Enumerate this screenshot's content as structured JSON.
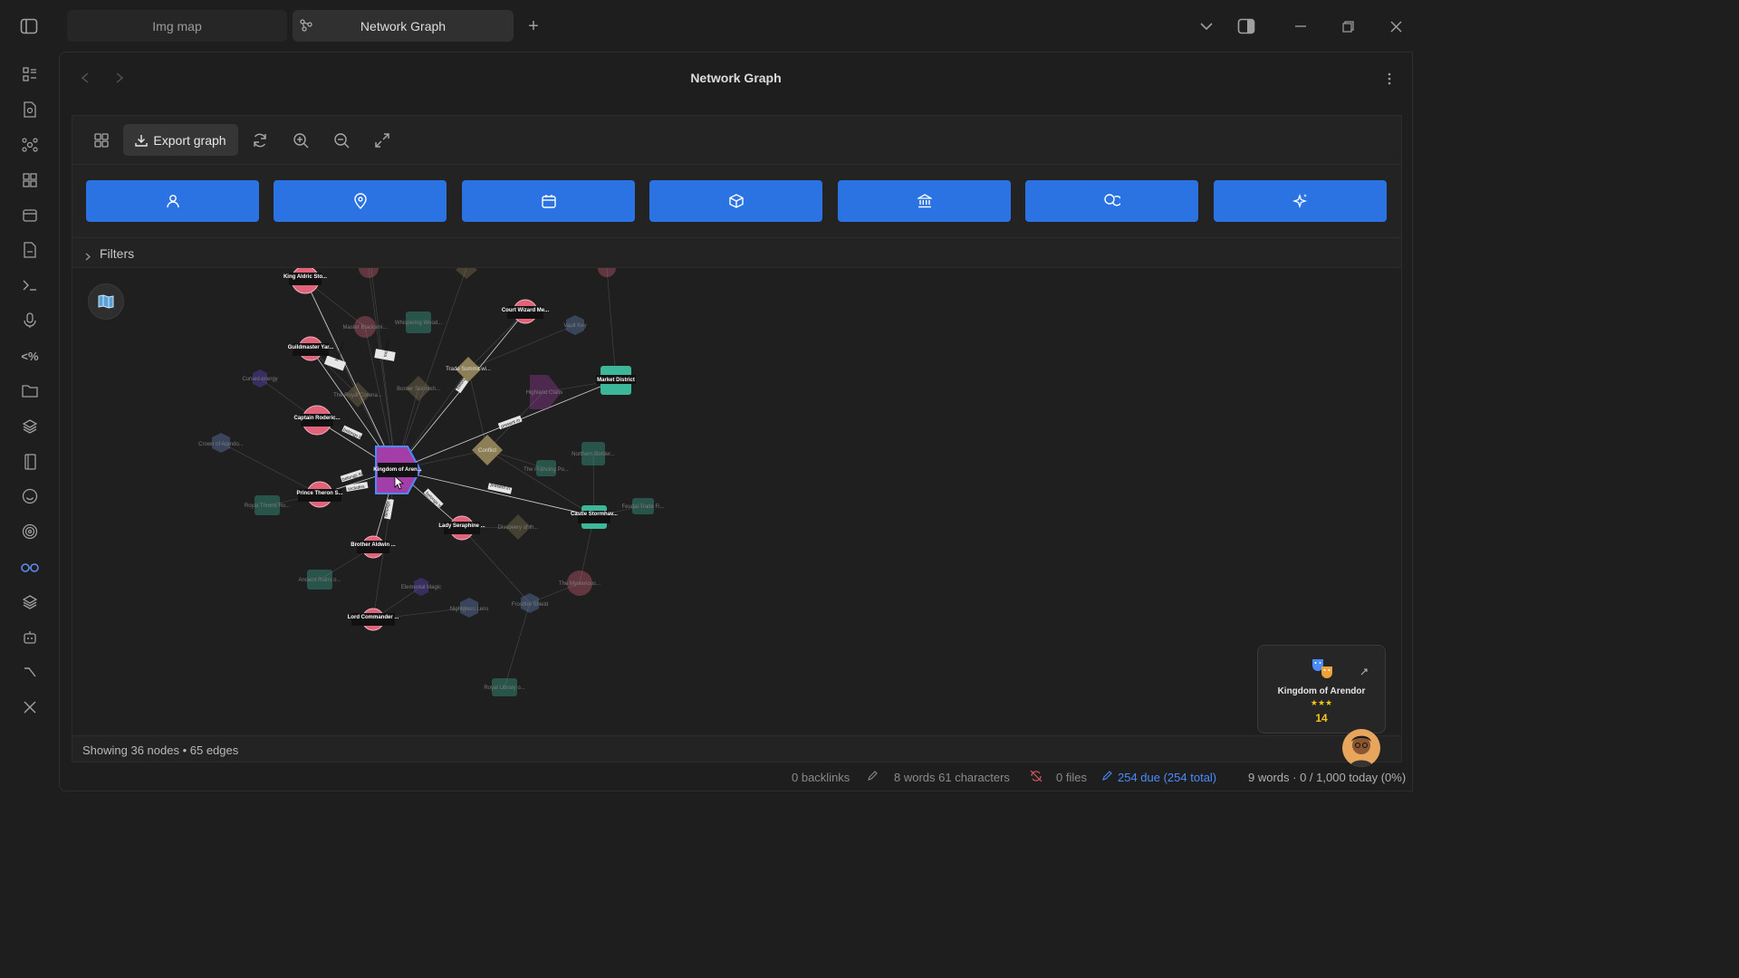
{
  "tabs": [
    {
      "label": "Img map",
      "active": false
    },
    {
      "label": "Network Graph",
      "active": true
    }
  ],
  "view": {
    "title": "Network Graph"
  },
  "toolbar": {
    "export_label": "Export graph"
  },
  "filter_buttons": [
    "person-icon",
    "location-pin-icon",
    "calendar-icon",
    "cube-icon",
    "institution-icon",
    "coins-icon",
    "sparkles-icon"
  ],
  "filters": {
    "label": "Filters"
  },
  "graph": {
    "focus_node": "Kingdom of Aren...",
    "nodes": [
      {
        "label": "King Aldric Sto...",
        "type": "character",
        "dim": false
      },
      {
        "label": "Court Wizard Me...",
        "type": "character",
        "dim": false
      },
      {
        "label": "Guildmaster Yar...",
        "type": "character",
        "dim": false
      },
      {
        "label": "Captain Roderic...",
        "type": "character",
        "dim": false
      },
      {
        "label": "Prince Theron S...",
        "type": "character",
        "dim": false
      },
      {
        "label": "Brother Aldwin ...",
        "type": "character",
        "dim": false
      },
      {
        "label": "Lady Seraphine ...",
        "type": "character",
        "dim": false
      },
      {
        "label": "Lord Commander ...",
        "type": "character",
        "dim": false
      },
      {
        "label": "Master Blacksmi...",
        "type": "character",
        "dim": true
      },
      {
        "label": "The Mysterious...",
        "type": "character",
        "dim": true
      },
      {
        "label": "Market District",
        "type": "place",
        "dim": false
      },
      {
        "label": "Castle Stormhav...",
        "type": "place",
        "dim": false
      },
      {
        "label": "Whispering Wood...",
        "type": "place",
        "dim": true
      },
      {
        "label": "Northern Border...",
        "type": "place",
        "dim": true
      },
      {
        "label": "The Prancing Po...",
        "type": "place",
        "dim": true
      },
      {
        "label": "Royal Throne Ro...",
        "type": "place",
        "dim": true
      },
      {
        "label": "Ancient Ruins o...",
        "type": "place",
        "dim": true
      },
      {
        "label": "Royal Library o...",
        "type": "place",
        "dim": true
      },
      {
        "label": "Feudal Trade Fi...",
        "type": "place",
        "dim": true
      },
      {
        "label": "Trade Summit wi...",
        "type": "event",
        "dim": false
      },
      {
        "label": "Conflict",
        "type": "event",
        "dim": false
      },
      {
        "label": "The Royal Corona...",
        "type": "event",
        "dim": true
      },
      {
        "label": "Border Skirmish...",
        "type": "event",
        "dim": true
      },
      {
        "label": "Discovery of th...",
        "type": "event",
        "dim": true
      },
      {
        "label": "Highland Clans",
        "type": "faction",
        "dim": true
      },
      {
        "label": "Vault Key",
        "type": "item",
        "dim": true
      },
      {
        "label": "Crown of Arendo...",
        "type": "item",
        "dim": true
      },
      {
        "label": "Nightglass Lens",
        "type": "item",
        "dim": true
      },
      {
        "label": "Frostfire Shield",
        "type": "item",
        "dim": true
      },
      {
        "label": "Cursed energy",
        "type": "concept",
        "dim": true
      },
      {
        "label": "Elemental Magic",
        "type": "concept",
        "dim": true
      }
    ],
    "edge_labels": [
      "belongs to",
      "includes",
      "present in"
    ]
  },
  "footer": {
    "stats": "Showing 36 nodes • 65 edges"
  },
  "card": {
    "title": "Kingdom of Arendor",
    "stars": "★★★",
    "count": "14"
  },
  "status": {
    "backlinks": "0 backlinks",
    "words_chars": "8 words  61 characters",
    "files": "0 files",
    "due": "254 due (254 total)",
    "today": "9 words · 0 / 1,000 today (0%)"
  },
  "colors": {
    "accent": "#2b73e3",
    "character": "#e0637a",
    "place": "#3db79a",
    "event": "#8d7f55",
    "focus": "#a33ea8"
  }
}
